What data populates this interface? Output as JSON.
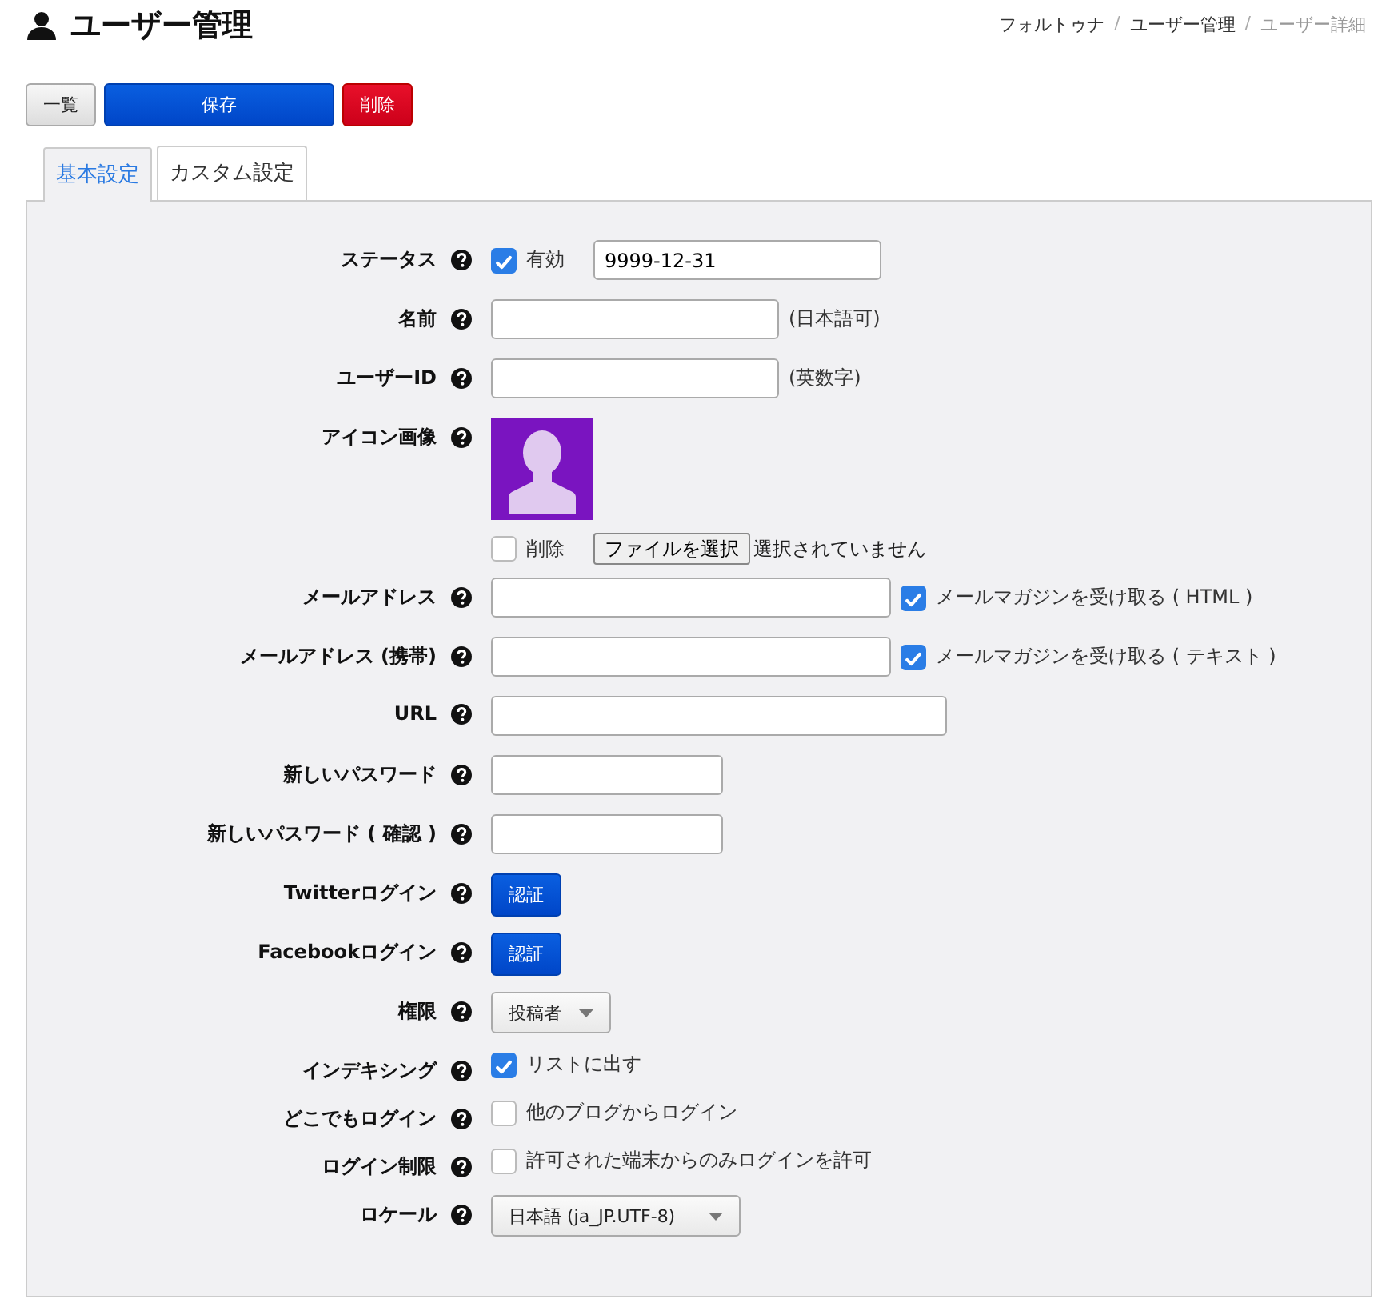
{
  "page": {
    "title": "ユーザー管理"
  },
  "breadcrumb": [
    {
      "label": "フォルトゥナ",
      "current": false
    },
    {
      "separator": "/",
      "label": "ユーザー管理",
      "current": false
    },
    {
      "separator": "/",
      "label": "ユーザー詳細",
      "current": true
    }
  ],
  "buttons": [
    {
      "label": "一覧",
      "kind": "default"
    },
    {
      "label": "保存",
      "kind": "primary"
    },
    {
      "label": "削除",
      "kind": "danger"
    }
  ],
  "tabs": [
    {
      "label": "基本設定",
      "selected": true
    },
    {
      "label": "カスタム設定",
      "selected": false
    }
  ],
  "fields": [
    {
      "label": "ステータス",
      "kind": "check_date",
      "checked": true,
      "check_label": "有効",
      "value": "9999-12-31"
    },
    {
      "label": "名前",
      "kind": "text",
      "note": "(日本語可)"
    },
    {
      "label": "ユーザーID",
      "kind": "text",
      "note": "(英数字)"
    },
    {
      "label": "アイコン画像",
      "kind": "avatar",
      "checked": false,
      "check_label": "削除",
      "file_button": "ファイルを選択",
      "file_status": "選択されていません"
    },
    {
      "label": "メールアドレス",
      "kind": "text_check",
      "checked": true,
      "check_label": "メールマガジンを受け取る ( HTML )"
    },
    {
      "label": "メールアドレス (携帯)",
      "kind": "text_check",
      "checked": true,
      "check_label": "メールマガジンを受け取る ( テキスト )"
    },
    {
      "label": "URL",
      "kind": "url"
    },
    {
      "label": "新しいパスワード",
      "kind": "password"
    },
    {
      "label": "新しいパスワード ( 確認 )",
      "kind": "password"
    },
    {
      "label": "Twitterログイン",
      "kind": "button",
      "button": "認証"
    },
    {
      "label": "Facebookログイン",
      "kind": "button",
      "button": "認証"
    },
    {
      "label": "権限",
      "kind": "select",
      "value": "投稿者"
    },
    {
      "label": "インデキシング",
      "kind": "check",
      "checked": true,
      "check_label": "リストに出す"
    },
    {
      "label": "どこでもログイン",
      "kind": "check",
      "checked": false,
      "check_label": "他のブログからログイン"
    },
    {
      "label": "ログイン制限",
      "kind": "check",
      "checked": false,
      "check_label": "許可された端末からのみログインを許可"
    },
    {
      "label": "ロケール",
      "kind": "locale",
      "value": "日本語 (ja_JP.UTF-8)"
    }
  ]
}
